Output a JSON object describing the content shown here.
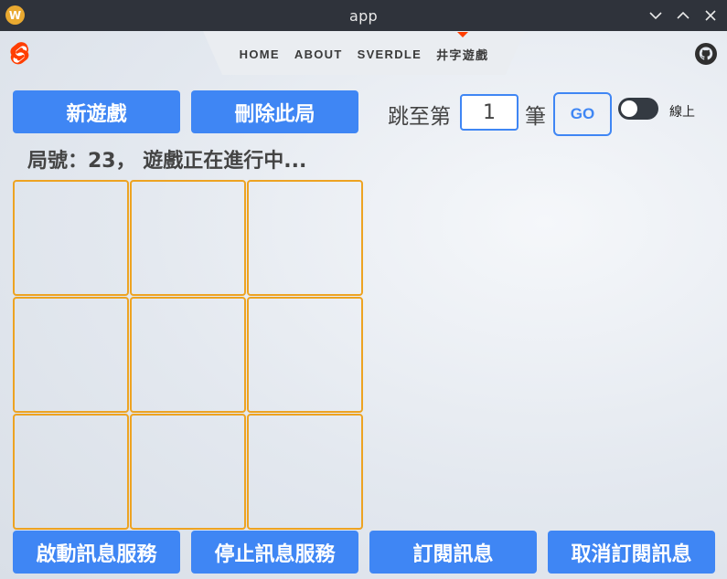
{
  "window": {
    "title": "app",
    "logo_letter": "W",
    "controls": [
      "chevron-down-icon",
      "chevron-up-icon",
      "close-icon"
    ]
  },
  "nav": {
    "items": [
      {
        "label": "HOME",
        "active": false
      },
      {
        "label": "ABOUT",
        "active": false
      },
      {
        "label": "SVERDLE",
        "active": false
      },
      {
        "label": "井字遊戲",
        "active": true
      }
    ]
  },
  "toolbar": {
    "new_game": "新遊戲",
    "delete_game": "刪除此局",
    "jump_prefix": "跳至第",
    "jump_value": "1",
    "jump_suffix": "筆",
    "go": "GO",
    "online_label": "線上",
    "online": false
  },
  "status": {
    "text": "局號：23， 遊戲正在進行中..."
  },
  "board": {
    "cells": [
      "",
      "",
      "",
      "",
      "",
      "",
      "",
      "",
      ""
    ]
  },
  "actions": {
    "start_service": "啟動訊息服務",
    "stop_service": "停止訊息服務",
    "subscribe": "訂閱訊息",
    "unsubscribe": "取消訂閱訊息"
  },
  "colors": {
    "primary": "#3f86f4",
    "cell_border": "#eda322",
    "svelte": "#ff3e00",
    "titlebar": "#2f333b"
  }
}
